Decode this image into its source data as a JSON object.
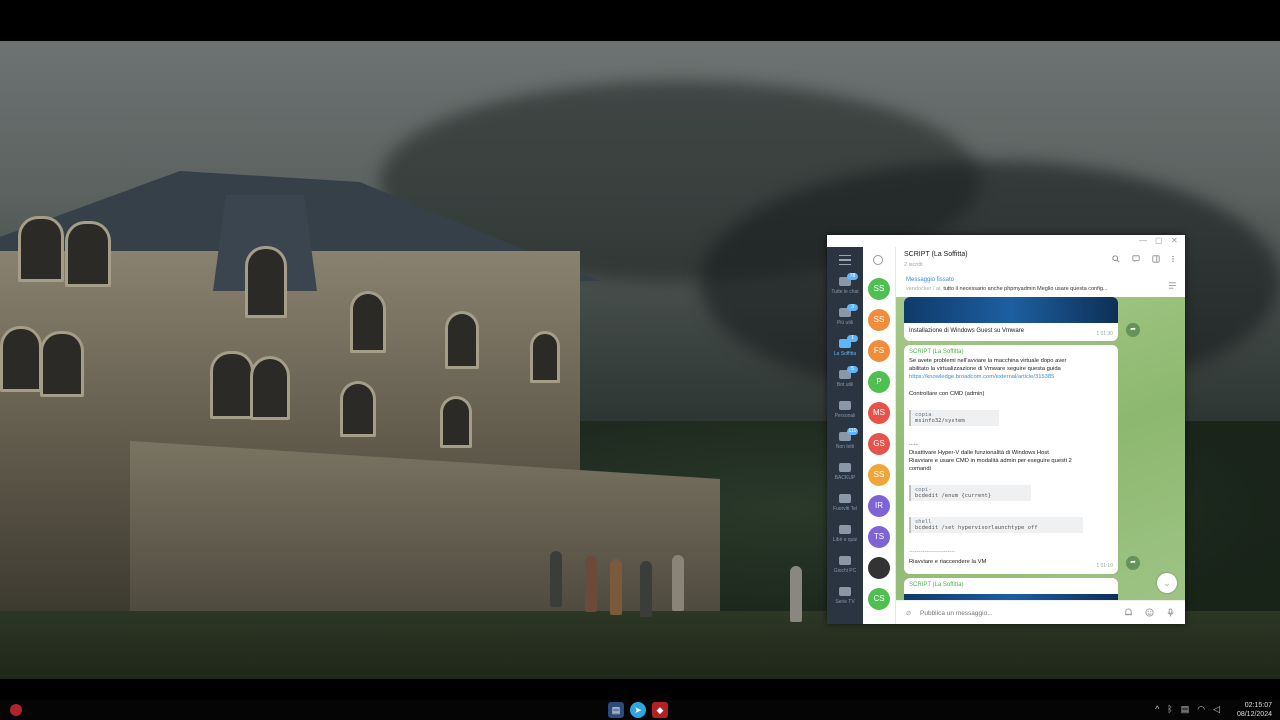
{
  "telegram": {
    "title": "SCRIPT (La Soffitta)",
    "subtitle": "2 iscritti",
    "folders": [
      {
        "label": "Tutte le chat",
        "badge": "78"
      },
      {
        "label": "Più utili",
        "badge": "3"
      },
      {
        "label": "La Soffitta",
        "badge": "1"
      },
      {
        "label": "Bot utili",
        "badge": "5"
      },
      {
        "label": "Personali",
        "badge": ""
      },
      {
        "label": "Non letti",
        "badge": "110"
      },
      {
        "label": "BACKUP",
        "badge": ""
      },
      {
        "label": "Fuorviti Tel",
        "badge": ""
      },
      {
        "label": "Libri e quiz",
        "badge": ""
      },
      {
        "label": "Giochi PC",
        "badge": ""
      },
      {
        "label": "Serie TV",
        "badge": ""
      }
    ],
    "chat_avatars": [
      {
        "initials": "SS",
        "color": "#4fbf52"
      },
      {
        "initials": "SS",
        "color": "#f08c3a"
      },
      {
        "initials": "FS",
        "color": "#f08c3a"
      },
      {
        "initials": "P",
        "color": "#4fbf52"
      },
      {
        "initials": "MS",
        "color": "#e5534b"
      },
      {
        "initials": "GS",
        "color": "#e5534b"
      },
      {
        "initials": "SS",
        "color": "#f0a53a"
      },
      {
        "initials": "IR",
        "color": "#7d63d6"
      },
      {
        "initials": "TS",
        "color": "#7d63d6"
      },
      {
        "initials": "",
        "color": "#333333"
      },
      {
        "initials": "CS",
        "color": "#4fbf52"
      }
    ],
    "pinned": {
      "title": "Messaggio fissato",
      "author": "vendocker / ai,",
      "text": "tutto il necessario anche phpmyadmin  Meglio usare questa config..."
    },
    "messages": {
      "video_caption": "Installazione di Windows Guest su Vmware",
      "video_meta": "1  01:30",
      "sender": "SCRIPT (La Soffitta)",
      "line1": "Se avete problemi nell'avviare la macchina virtuale dopo aver",
      "line2": "abilitato la virtualizzazione di Vmware seguire questa guida",
      "link": "https://knowledge.broadcom.com/external/article/315385",
      "line3": "Controllare con CMD (admin)",
      "code1_lang": "copia",
      "code1": "msinfo32/system",
      "dots": "......",
      "line4": "Disattivare Hyper-V dalle funzionalità di Windows Host",
      "line5": "Riavviare e usare CMD in modalità admin per eseguire questi 2",
      "line6": "comandi",
      "code2_lang": "copi-",
      "code2": "bcdedit /enum {current}",
      "code3_lang": "shell",
      "code3": "bcdedit /set hypervisorlaunchtype off",
      "dashes": "------------------------",
      "line7": "Riavviare e riaccendere la VM",
      "msg_meta": "1  01:10",
      "next_sender": "SCRIPT (La Soffitta)"
    },
    "composer_placeholder": "Pubblica un messaggio..."
  },
  "taskbar": {
    "time": "02:15:07",
    "date": "08/12/2024"
  }
}
